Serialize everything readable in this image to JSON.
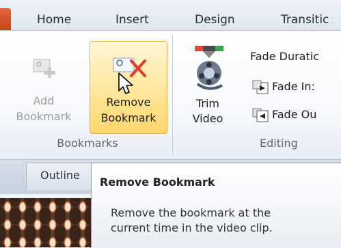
{
  "tabs": [
    "Home",
    "Insert",
    "Design",
    "Transitic"
  ],
  "ribbon": {
    "bookmarks": {
      "add": {
        "line1": "Add",
        "line2": "Bookmark",
        "icon": "add-bookmark-icon",
        "enabled": false
      },
      "remove": {
        "line1": "Remove",
        "line2": "Bookmark",
        "icon": "remove-bookmark-icon",
        "enabled": true
      },
      "group_label": "Bookmarks"
    },
    "editing": {
      "trim": {
        "line1": "Trim",
        "line2": "Video",
        "icon": "trim-video-icon"
      },
      "fade_duration": "Fade Duratic",
      "fade_in": "Fade In:",
      "fade_out": "Fade Ou",
      "group_label": "Editing"
    }
  },
  "panel": {
    "outline_tab": "Outline"
  },
  "tooltip": {
    "title": "Remove Bookmark",
    "line1": "Remove the bookmark at the",
    "line2": "current time in the video clip."
  },
  "colors": {
    "hover_fill": "#ffe08a",
    "hover_border": "#e3b04b",
    "remove_x": "#e23a2a",
    "file_tab": "#d9542a"
  }
}
